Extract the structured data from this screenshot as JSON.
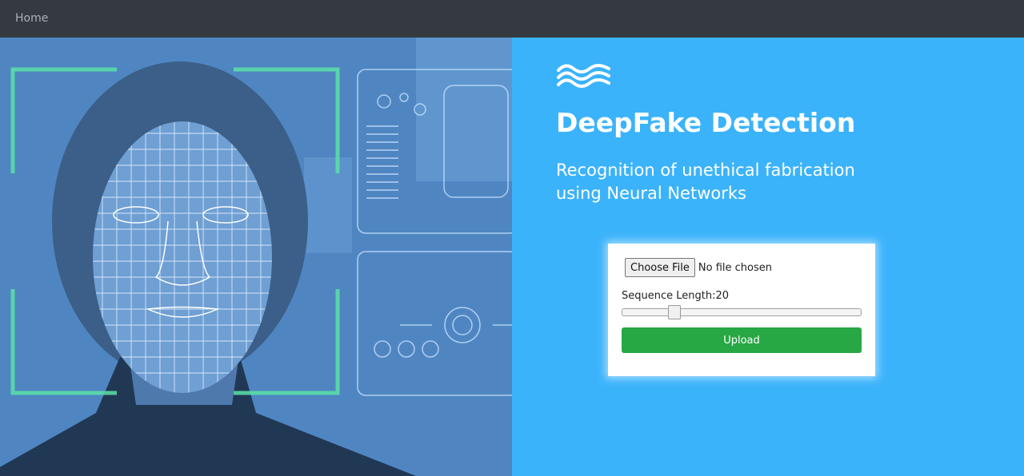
{
  "nav": {
    "home_label": "Home"
  },
  "hero": {
    "image_name": "face-scan-image"
  },
  "brand": {
    "title": "DeepFake Detection",
    "subtitle_line1": "Recognition of unethical fabrication",
    "subtitle_line2": "using Neural Networks"
  },
  "form": {
    "choose_file_label": "Choose File",
    "file_status": "No file chosen",
    "sequence_label": "Sequence Length:",
    "sequence_value": "20",
    "sequence_fraction": 0.2,
    "upload_label": "Upload"
  },
  "colors": {
    "navbar": "#343a40",
    "panel": "#3bb3fb",
    "upload_button": "#28a745"
  }
}
